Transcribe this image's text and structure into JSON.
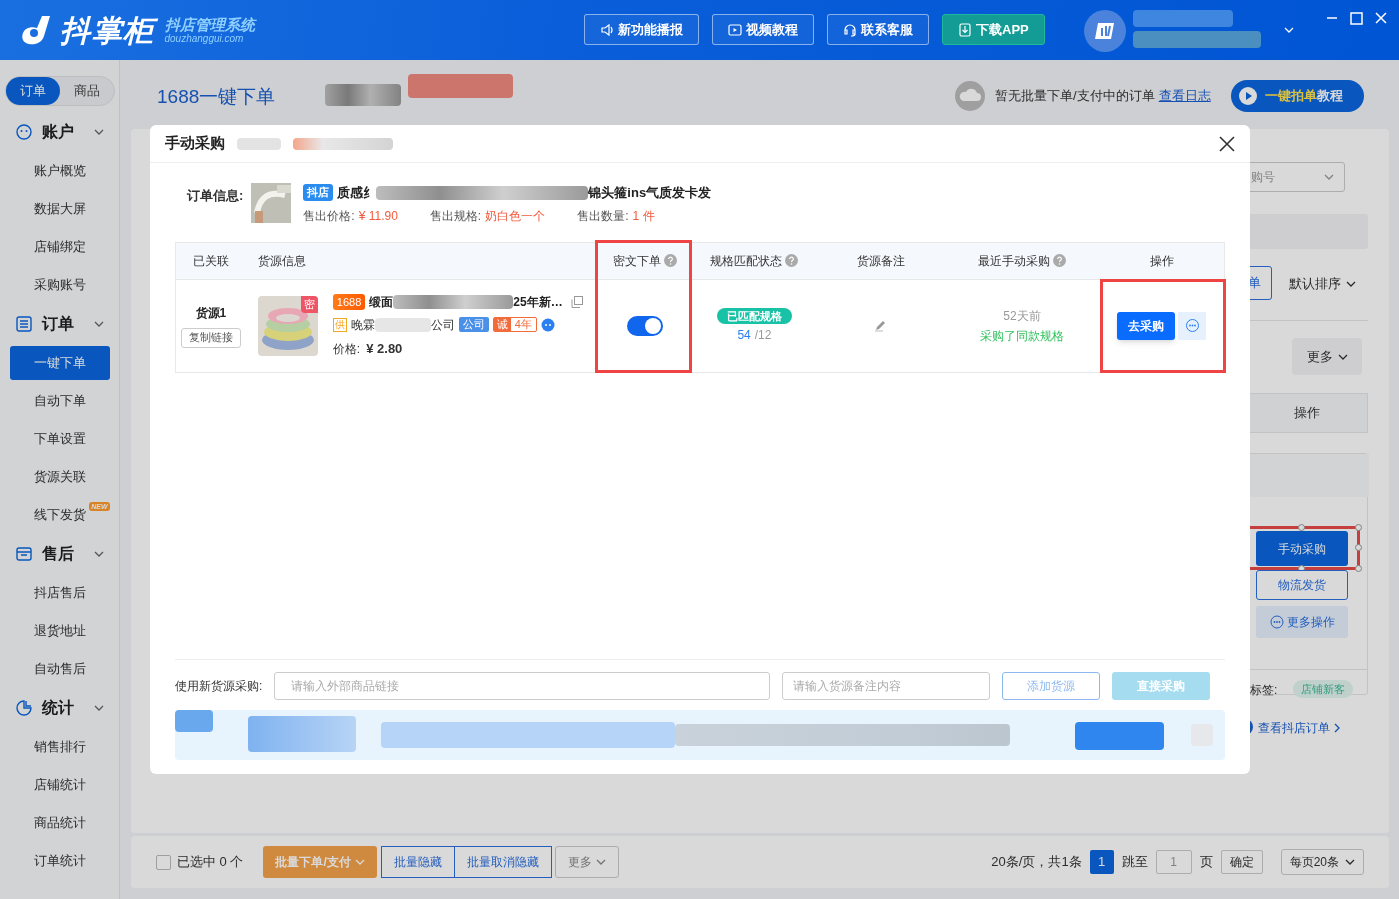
{
  "header": {
    "logo": "抖掌柜",
    "logo_tagline": "抖店管理系统",
    "logo_domain": "douzhanggui.com",
    "buttons": [
      {
        "label": "新功能播报",
        "kind": "outline"
      },
      {
        "label": "视频教程",
        "kind": "outline"
      },
      {
        "label": "联系客服",
        "kind": "outline"
      },
      {
        "label": "下载APP",
        "kind": "primary"
      }
    ]
  },
  "sidebar": {
    "toggle": [
      {
        "label": "订单",
        "selected": true
      },
      {
        "label": "商品",
        "selected": false
      }
    ],
    "sections": [
      {
        "title": "账户",
        "expanded": true,
        "items": [
          {
            "label": "账户概览",
            "selected": false
          },
          {
            "label": "数据大屏",
            "selected": false
          },
          {
            "label": "店铺绑定",
            "selected": false
          },
          {
            "label": "采购账号",
            "selected": false
          }
        ]
      },
      {
        "title": "订单",
        "expanded": true,
        "items": [
          {
            "label": "一键下单",
            "selected": true
          },
          {
            "label": "自动下单",
            "selected": false
          },
          {
            "label": "下单设置",
            "selected": false
          },
          {
            "label": "货源关联",
            "selected": false
          },
          {
            "label": "线下发货",
            "selected": false,
            "badge": "NEW"
          }
        ]
      },
      {
        "title": "售后",
        "expanded": true,
        "items": [
          {
            "label": "抖店售后",
            "selected": false
          },
          {
            "label": "退货地址",
            "selected": false
          },
          {
            "label": "自动售后",
            "selected": false
          }
        ]
      },
      {
        "title": "统计",
        "expanded": true,
        "items": [
          {
            "label": "销售排行",
            "selected": false
          },
          {
            "label": "店铺统计",
            "selected": false
          },
          {
            "label": "商品统计",
            "selected": false
          },
          {
            "label": "订单统计",
            "selected": false
          }
        ]
      }
    ]
  },
  "page": {
    "title": "1688一键下单",
    "batch_status": "暂无批量下单/支付中的订单",
    "log_link": "查看日志",
    "tutorial_highlight": "一键拍单",
    "tutorial_rest": "教程"
  },
  "background": {
    "select_tail": "购号",
    "button_tail": "单",
    "sort": "默认排序",
    "more": "更多",
    "column": "操作",
    "manual_button": {
      "label": "手动采购",
      "highlighted": true
    },
    "logistics": "物流发货",
    "more_actions": "更多操作",
    "tag_label": "标签:",
    "tag": "店铺新客",
    "view_link": "查看抖店订单"
  },
  "modal": {
    "title": "手动采购",
    "order": {
      "label": "订单信息:",
      "platform_tag": "抖店",
      "title_start": "质感纟",
      "title_end": "锦头箍ins气质发卡发",
      "fields": [
        {
          "label": "售出价格:",
          "value": "¥ 11.90"
        },
        {
          "label": "售出规格:",
          "value": "奶白色一个"
        },
        {
          "label": "售出数量:",
          "value": "1 件"
        }
      ]
    },
    "columns": [
      {
        "label": "已关联",
        "help": false
      },
      {
        "label": "货源信息",
        "help": false
      },
      {
        "label": "密文下单",
        "help": true
      },
      {
        "label": "规格匹配状态",
        "help": true
      },
      {
        "label": "货源备注",
        "help": false
      },
      {
        "label": "最近手动采购",
        "help": true
      },
      {
        "label": "操作",
        "help": false
      }
    ],
    "rows": [
      {
        "name": "货源1",
        "copy_button": "复制链接",
        "image_badge": "密",
        "source_tag": "1688",
        "title_start": "缎面",
        "title_end": "25年新…",
        "supplier_mark": "供",
        "supplier_start": "晚霖",
        "supplier_end": "公司",
        "company_tag": "公司",
        "integrity_tag": "诚",
        "integrity_years": "4年",
        "price_label": "价格:",
        "price": "¥ 2.80",
        "cipher_on": true,
        "match_status": "已匹配规格",
        "match_count": "54",
        "match_total": "/12",
        "last_purchase": "52天前",
        "last_purchase_note": "采购了同款规格",
        "action": "去采购",
        "cipher_highlighted": true,
        "actions_highlighted": true
      }
    ],
    "new_source": {
      "label": "使用新货源采购:",
      "link_placeholder": "请输入外部商品链接",
      "note_placeholder": "请输入货源备注内容",
      "add_button": "添加货源",
      "direct_button": "直接采购",
      "direct_disabled": true
    }
  },
  "bottom_bar": {
    "select_all": {
      "label": "已选中 0 个",
      "checked": false
    },
    "batch_buttons": [
      {
        "label": "批量下单/支付",
        "kind": "primary"
      },
      {
        "label": "批量隐藏",
        "kind": "outline"
      },
      {
        "label": "批量取消隐藏",
        "kind": "outline"
      },
      {
        "label": "更多",
        "kind": "plain"
      }
    ],
    "summary": "20条/页，共1条",
    "pages": [
      {
        "label": "1",
        "selected": true
      }
    ],
    "jump_label": "跳至",
    "jump_value": "1",
    "page_unit": "页",
    "confirm": "确定",
    "page_size": "每页20条"
  }
}
